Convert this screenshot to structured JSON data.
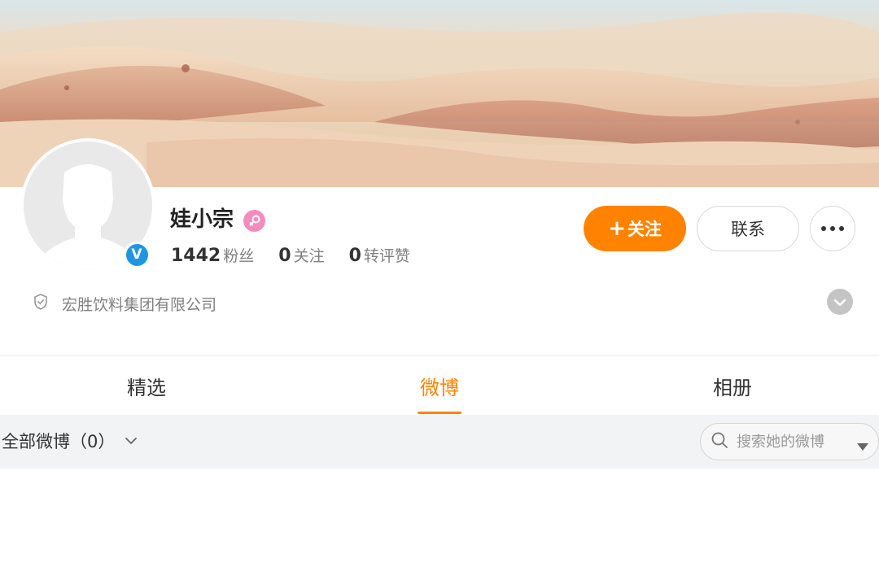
{
  "profile": {
    "username": "娃小宗",
    "gender_icon": "female-icon",
    "verified_icon": "verified-v-icon",
    "verified_letter": "V",
    "company": "宏胜饮料集团有限公司"
  },
  "stats": [
    {
      "value": "1442",
      "label": "粉丝"
    },
    {
      "value": "0",
      "label": "关注"
    },
    {
      "value": "0",
      "label": "转评赞"
    }
  ],
  "actions": {
    "follow_plus": "+",
    "follow_label": "关注",
    "contact_label": "联系"
  },
  "tabs": [
    {
      "label": "精选",
      "active": false
    },
    {
      "label": "微博",
      "active": true
    },
    {
      "label": "相册",
      "active": false
    }
  ],
  "filter": {
    "label": "全部微博（0）",
    "search_placeholder": "搜索她的微博"
  },
  "colors": {
    "accent": "#ff8200",
    "verified": "#1e96e6",
    "gender": "#f48bbf",
    "filter_bg": "#f2f3f5"
  }
}
